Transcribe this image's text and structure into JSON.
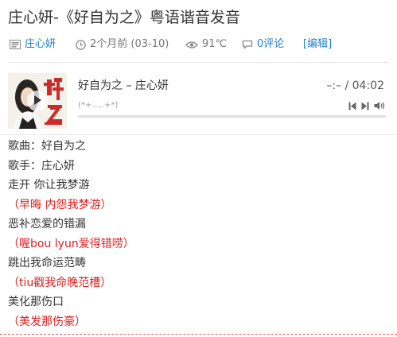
{
  "title": "庄心妍-《好自为之》粤语谐音发音",
  "meta": {
    "author": "庄心妍",
    "date": "2个月前 (03-10)",
    "views": "91℃",
    "comments": "0评论",
    "edit": "[编辑]"
  },
  "player": {
    "song": "好自为之 – 庄心妍",
    "time": "–:– / 04:02",
    "lyric": "(*+.....+*)",
    "progress": 0
  },
  "lyrics": [
    {
      "text": "歌曲：好自为之",
      "style": "plain"
    },
    {
      "text": "歌手：庄心妍",
      "style": "plain"
    },
    {
      "text": "走开 你让我梦游",
      "style": "plain"
    },
    {
      "text": "（早晦 内怨我梦游）",
      "style": "red"
    },
    {
      "text": "恶补恋爱的错漏",
      "style": "plain"
    },
    {
      "text": "（喔bou lyun爱得错唠）",
      "style": "red"
    },
    {
      "text": "跳出我命运范畴",
      "style": "plain"
    },
    {
      "text": "（tiu戳我命晚范槽）",
      "style": "red"
    },
    {
      "text": "美化那伤口",
      "style": "plain"
    },
    {
      "text": "（美发那伤豪）",
      "style": "red"
    }
  ],
  "colors": {
    "link": "#1f7fc9",
    "red_lyric": "#e02020",
    "meta_gray": "#777777"
  }
}
